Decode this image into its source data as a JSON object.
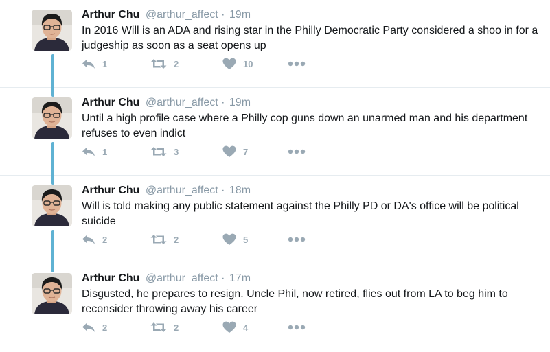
{
  "thread": {
    "tweets": [
      {
        "author_name": "Arthur Chu",
        "author_handle": "@arthur_affect",
        "separator": "·",
        "time": "19m",
        "text": "In 2016 Will is an ADA and rising star in the Philly Democratic Party considered a shoo in for a judgeship as soon as a seat opens up",
        "replies": "1",
        "retweets": "2",
        "likes": "10"
      },
      {
        "author_name": "Arthur Chu",
        "author_handle": "@arthur_affect",
        "separator": "·",
        "time": "19m",
        "text": "Until a high profile case where a Philly cop guns down an unarmed man and his department refuses to even indict",
        "replies": "1",
        "retweets": "3",
        "likes": "7"
      },
      {
        "author_name": "Arthur Chu",
        "author_handle": "@arthur_affect",
        "separator": "·",
        "time": "18m",
        "text": "Will is told making any public statement against the Philly PD or DA's office will be political suicide",
        "replies": "2",
        "retweets": "2",
        "likes": "5"
      },
      {
        "author_name": "Arthur Chu",
        "author_handle": "@arthur_affect",
        "separator": "·",
        "time": "17m",
        "text": "Disgusted, he prepares to resign. Uncle Phil, now retired, flies out from LA to beg him to reconsider throwing away his career",
        "replies": "2",
        "retweets": "2",
        "likes": "4"
      }
    ]
  },
  "icons": {
    "reply": "reply-icon",
    "retweet": "retweet-icon",
    "like": "heart-icon",
    "more": "more-dots-icon"
  },
  "colors": {
    "thread_line": "#5fb2d3",
    "muted": "#8899a6",
    "text": "#14171a",
    "divider": "#e6ecf0"
  }
}
